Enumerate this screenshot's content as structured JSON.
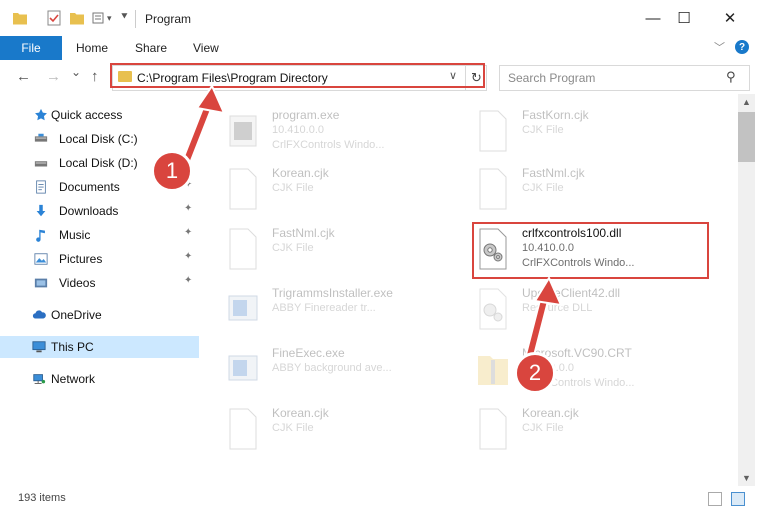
{
  "window": {
    "title": "Program",
    "minimize_glyph": "—",
    "maximize_glyph": "☐",
    "close_glyph": "✕"
  },
  "ribbon": {
    "tabs": [
      "File",
      "Home",
      "Share",
      "View"
    ],
    "collapse_glyph": "﹀",
    "help_glyph": "?"
  },
  "address": {
    "back_glyph": "←",
    "forward_glyph": "→",
    "dropdown_glyph": "⌄",
    "up_glyph": "↑",
    "path": "C:\\Program Files\\Program Directory",
    "path_dropdown_glyph": "∨",
    "refresh_glyph": "↻"
  },
  "search": {
    "placeholder": "Search Program",
    "icon_glyph": "⚲"
  },
  "nav_pane": {
    "items": [
      {
        "label": "Quick access",
        "icon": "star-icon",
        "pinned": false
      },
      {
        "label": "Local Disk (C:)",
        "icon": "drive-icon",
        "pinned": false
      },
      {
        "label": "Local Disk (D:)",
        "icon": "drive-icon",
        "pinned": true
      },
      {
        "label": "Documents",
        "icon": "documents-icon",
        "pinned": true
      },
      {
        "label": "Downloads",
        "icon": "downloads-icon",
        "pinned": true
      },
      {
        "label": "Music",
        "icon": "music-icon",
        "pinned": true
      },
      {
        "label": "Pictures",
        "icon": "pictures-icon",
        "pinned": true
      },
      {
        "label": "Videos",
        "icon": "videos-icon",
        "pinned": true
      },
      {
        "label": "OneDrive",
        "icon": "onedrive-icon",
        "pinned": false
      },
      {
        "label": "This PC",
        "icon": "computer-icon",
        "pinned": false,
        "selected": true
      },
      {
        "label": "Network",
        "icon": "network-icon",
        "pinned": false
      }
    ],
    "pin_glyph": "📌"
  },
  "files": [
    {
      "name": "program.exe",
      "line2": "10.410.0.0",
      "line3": "CrlFXControls Windo...",
      "icon": "exe-icon"
    },
    {
      "name": "FastKorn.cjk",
      "line2": "CJK File",
      "line3": "",
      "icon": "file-icon"
    },
    {
      "name": "Korean.cjk",
      "line2": "CJK File",
      "line3": "",
      "icon": "file-icon"
    },
    {
      "name": "FastNml.cjk",
      "line2": "CJK File",
      "line3": "",
      "icon": "file-icon"
    },
    {
      "name": "FastNml.cjk",
      "line2": "CJK File",
      "line3": "",
      "icon": "file-icon"
    },
    {
      "name": "crlfxcontrols100.dll",
      "line2": "10.410.0.0",
      "line3": "CrlFXControls Windo...",
      "icon": "dll-gear-icon",
      "highlighted": true
    },
    {
      "name": "TrigrammsInstaller.exe",
      "line2": "ABBY Finereader tr...",
      "line3": "",
      "icon": "installer-icon"
    },
    {
      "name": "UpdateClient42.dll",
      "line2": "Resource DLL",
      "line3": "",
      "icon": "dll-gear-icon"
    },
    {
      "name": "FineExec.exe",
      "line2": "ABBY background ave...",
      "line3": "",
      "icon": "installer-icon"
    },
    {
      "name": "Microsoft.VC90.CRT",
      "line2": "10.410.0.0",
      "line3": "CrlFXControls Windo...",
      "icon": "folder-zip-icon"
    },
    {
      "name": "Korean.cjk",
      "line2": "CJK File",
      "line3": "",
      "icon": "file-icon"
    },
    {
      "name": "Korean.cjk",
      "line2": "CJK File",
      "line3": "",
      "icon": "file-icon"
    }
  ],
  "status": {
    "item_count": "193 items"
  },
  "annotations": {
    "step1": "1",
    "step2": "2"
  },
  "colors": {
    "accent": "#1979ca",
    "highlight": "#d9453e",
    "selected_bg": "#cce8ff",
    "folder": "#e8c04f"
  }
}
